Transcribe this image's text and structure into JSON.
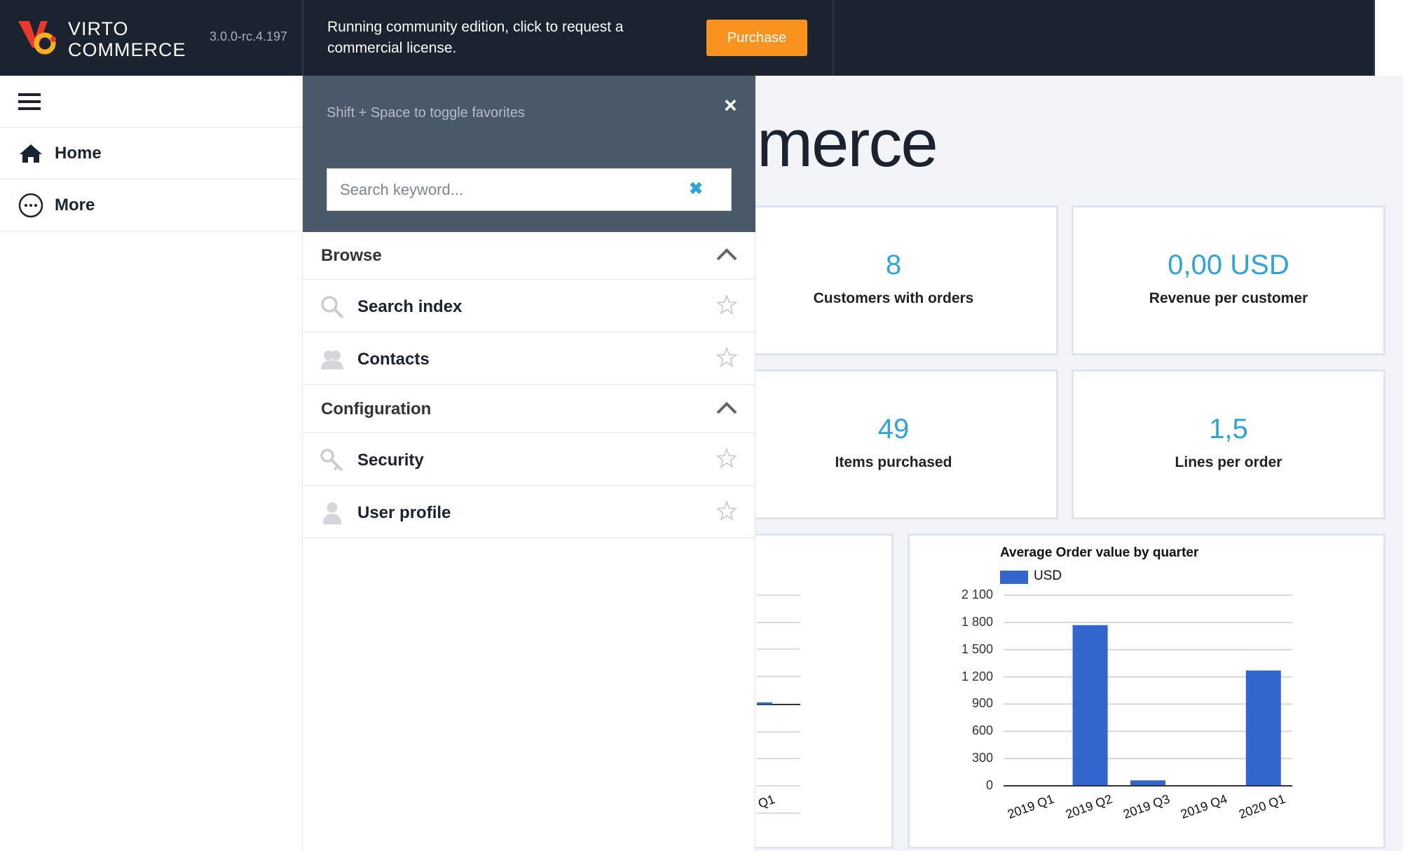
{
  "header": {
    "brand_line1": "VIRTO",
    "brand_line2": "COMMERCE",
    "version": "3.0.0-rc.4.197",
    "notice": "Running community edition, click to request a commercial license.",
    "purchase_label": "Purchase",
    "accent_color": "#f7931e"
  },
  "leftnav": {
    "items": [
      {
        "label": "Home",
        "icon": "home-icon"
      },
      {
        "label": "More",
        "icon": "more-icon"
      }
    ]
  },
  "panel": {
    "hint": "Shift + Space to toggle favorites",
    "close_icon": "×",
    "search_placeholder": "Search keyword...",
    "search_value": "",
    "clear_icon": "✖",
    "sections": [
      {
        "title": "Browse",
        "items": [
          {
            "label": "Search index",
            "icon": "search-icon"
          },
          {
            "label": "Contacts",
            "icon": "contacts-icon"
          }
        ]
      },
      {
        "title": "Configuration",
        "items": [
          {
            "label": "Security",
            "icon": "key-icon"
          },
          {
            "label": "User profile",
            "icon": "user-icon"
          }
        ]
      }
    ]
  },
  "dashboard": {
    "title_visible": "merce",
    "cards": [
      {
        "value": "8",
        "label": "Customers with orders"
      },
      {
        "value": "0,00 USD",
        "label": "Revenue per customer"
      },
      {
        "value": "49",
        "label": "Items purchased"
      },
      {
        "value": "1,5",
        "label": "Lines per order"
      }
    ],
    "left_chart_partial_tick": "Q1"
  },
  "chart_data": {
    "type": "bar",
    "title": "Average Order value by quarter",
    "categories": [
      "2019 Q1",
      "2019 Q2",
      "2019 Q3",
      "2019 Q4",
      "2020 Q1"
    ],
    "series": [
      {
        "name": "USD",
        "values": [
          0,
          1770,
          60,
          0,
          1270
        ],
        "color": "#3366cc"
      }
    ],
    "yticks": [
      "0",
      "300",
      "600",
      "900",
      "1 200",
      "1 500",
      "1 800",
      "2 100"
    ],
    "ylim": [
      0,
      2100
    ],
    "grid": true,
    "legend": "top-left"
  }
}
